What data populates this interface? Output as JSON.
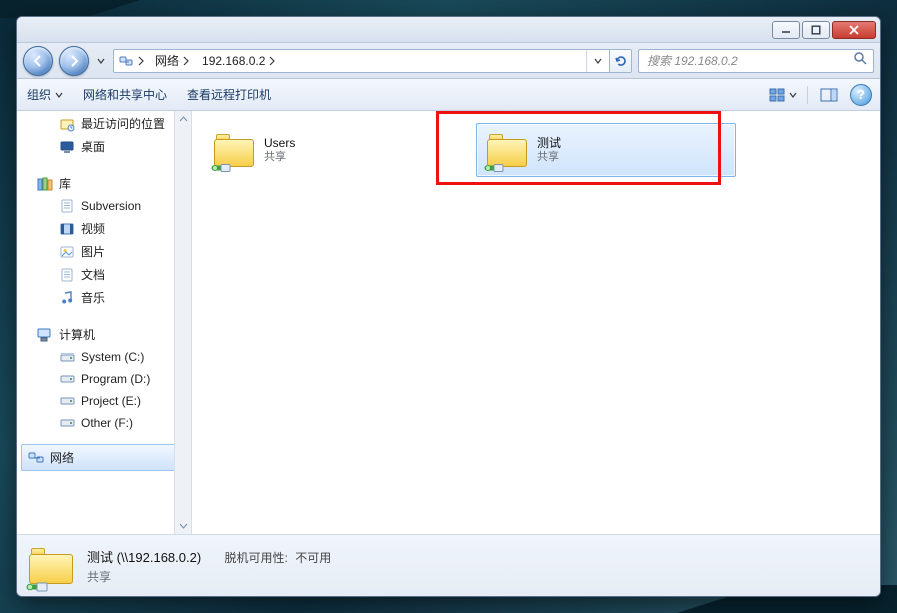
{
  "breadcrumb": {
    "root_label": "网络",
    "host_label": "192.168.0.2"
  },
  "search": {
    "placeholder": "搜索 192.168.0.2"
  },
  "cmdbar": {
    "organize": "组织",
    "network_center": "网络和共享中心",
    "remote_printer": "查看远程打印机"
  },
  "sidebar": {
    "recent": "最近访问的位置",
    "desktop": "桌面",
    "libraries": "库",
    "subversion": "Subversion",
    "videos": "视频",
    "pictures": "图片",
    "documents": "文档",
    "music": "音乐",
    "computer": "计算机",
    "drive_c": "System (C:)",
    "drive_d": "Program (D:)",
    "drive_e": "Project (E:)",
    "drive_f": "Other (F:)",
    "network": "网络"
  },
  "items": {
    "users": {
      "name": "Users",
      "sub": "共享"
    },
    "test": {
      "name": "测试",
      "sub": "共享"
    }
  },
  "details": {
    "title": "测试 (\\\\192.168.0.2)",
    "sub": "共享",
    "status_label": "脱机可用性:",
    "status_value": "不可用"
  }
}
